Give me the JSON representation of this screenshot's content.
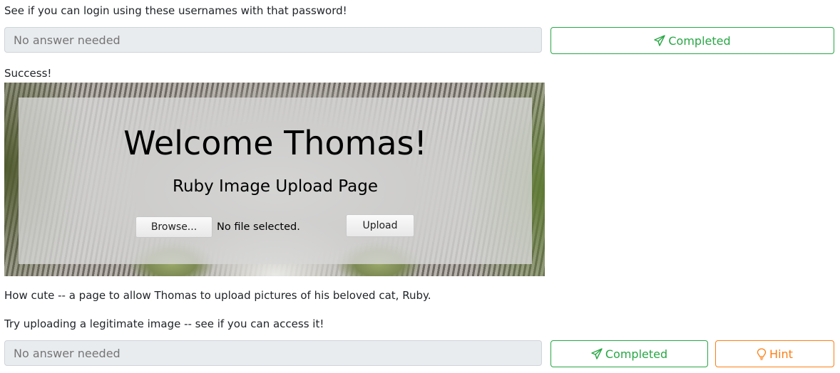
{
  "task1": {
    "prompt": "See if you can login using these usernames with that password!",
    "answer_placeholder": "No answer needed",
    "completed_label": "Completed"
  },
  "result": {
    "text": "Success!"
  },
  "screenshot": {
    "welcome": "Welcome Thomas!",
    "subtitle": "Ruby Image Upload Page",
    "browse_label": "Browse...",
    "file_status": "No file selected.",
    "upload_label": "Upload"
  },
  "task2": {
    "description": "How cute -- a page to allow Thomas to upload pictures of his beloved cat, Ruby.",
    "prompt": "Try uploading a legitimate image -- see if you can access it!",
    "answer_placeholder": "No answer needed",
    "completed_label": "Completed",
    "hint_label": "Hint"
  },
  "colors": {
    "success": "#28a745",
    "hint": "#fd7e14",
    "disabled_input": "#e9ecef"
  },
  "icons": {
    "completed": "paper-plane-icon",
    "hint": "lightbulb-icon"
  }
}
